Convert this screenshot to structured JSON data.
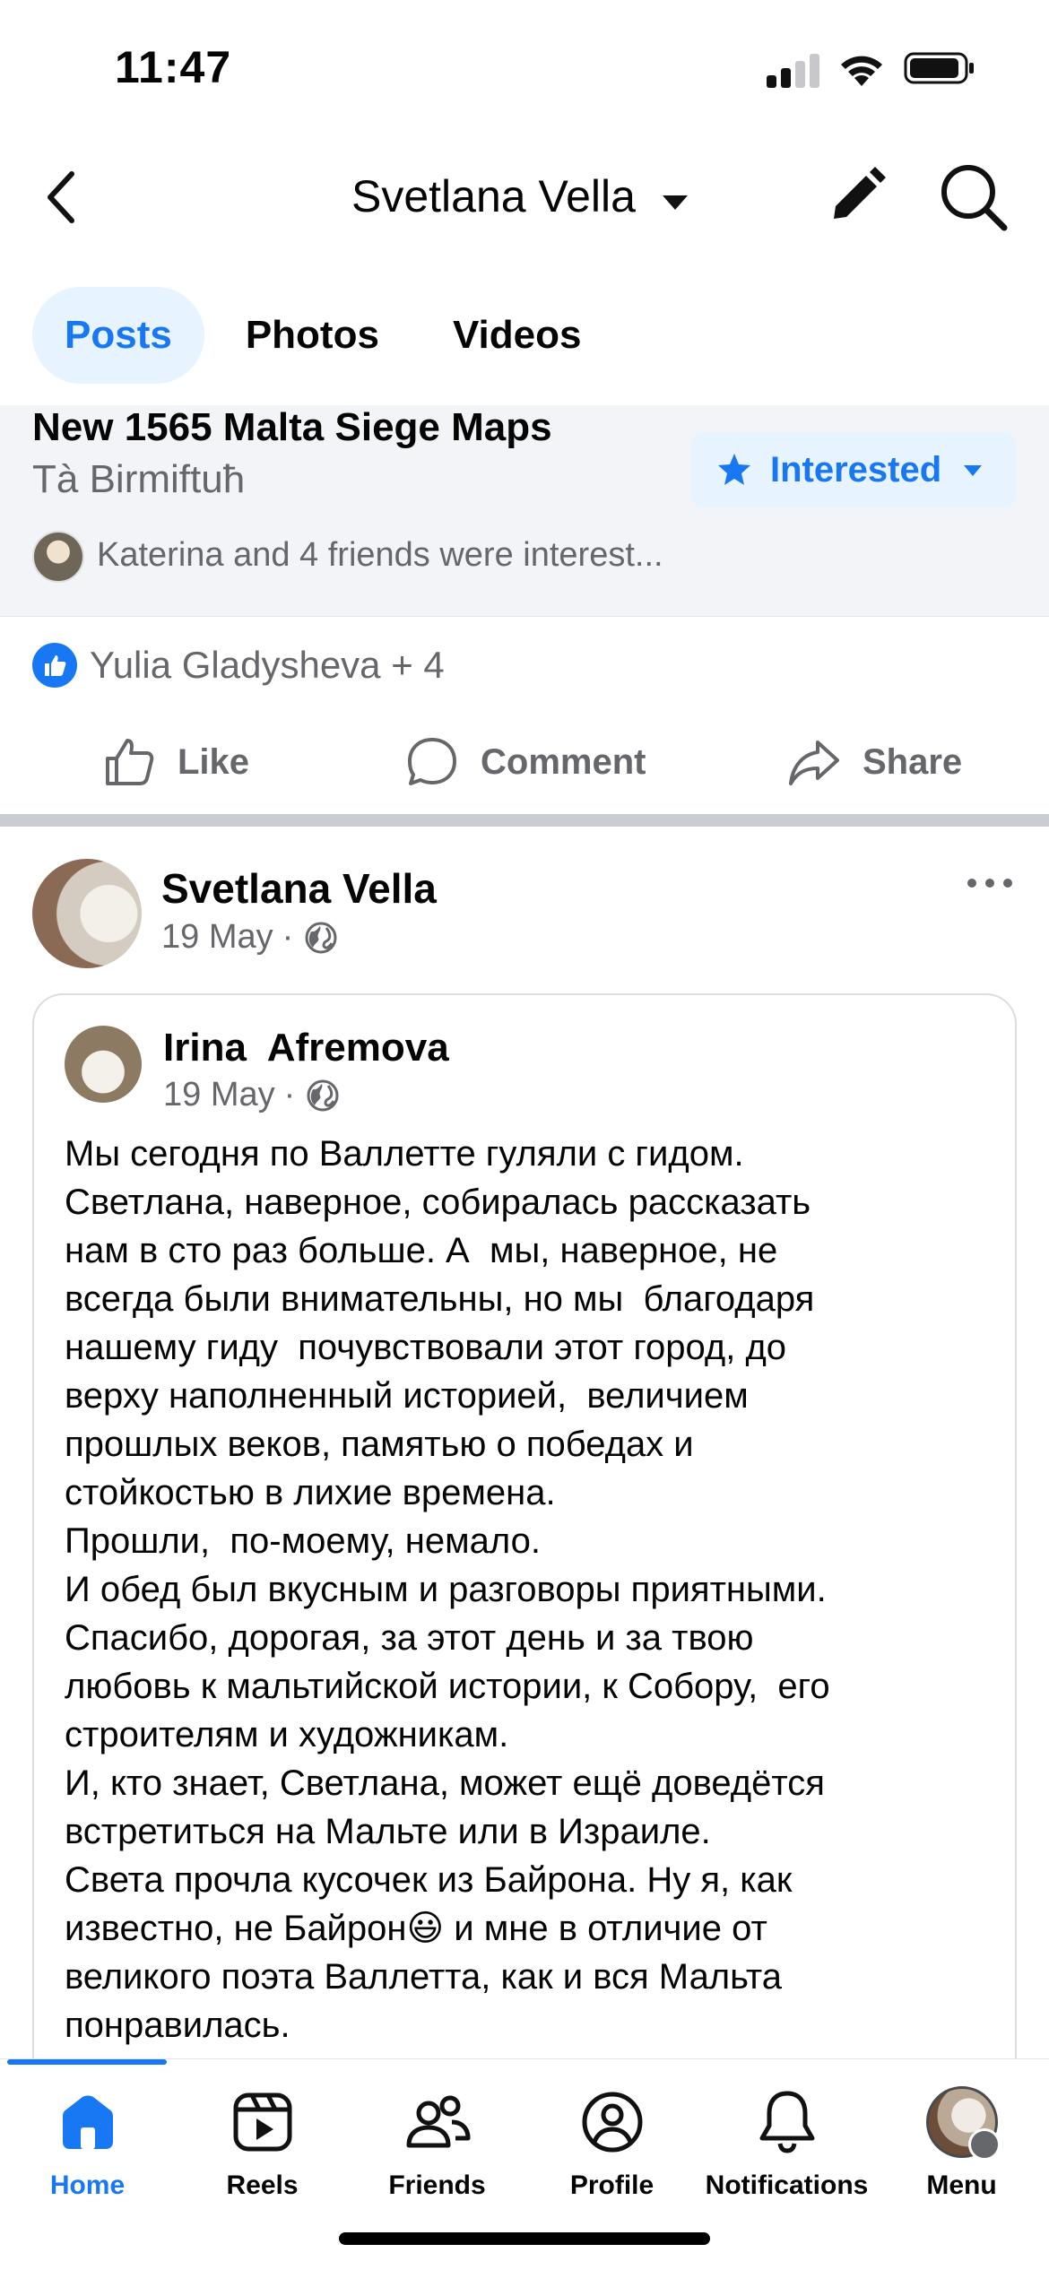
{
  "status_bar": {
    "time": "11:47"
  },
  "header": {
    "title": "Svetlana Vella"
  },
  "tabs": [
    {
      "label": "Posts",
      "active": true
    },
    {
      "label": "Photos",
      "active": false
    },
    {
      "label": "Videos",
      "active": false
    }
  ],
  "event": {
    "title": "New 1565 Malta Siege Maps",
    "location": "Tà Birmiftuħ",
    "interested_label": "Interested",
    "friends_text": "Katerina and 4 friends were interest..."
  },
  "reactions": {
    "names": "Yulia Gladysheva + 4"
  },
  "actions": {
    "like": "Like",
    "comment": "Comment",
    "share": "Share"
  },
  "post": {
    "author": "Svetlana Vella",
    "date": "19 May",
    "separator": "·",
    "shared": {
      "author": "Irina  Afremova",
      "date": "19 May",
      "separator": "·",
      "text": "Мы сегодня по Валлетте гуляли с гидом.\nСветлана, наверное, собиралась рассказать\nнам в сто раз больше. А  мы, наверное, не\nвсегда были внимательны, но мы  благодаря\nнашему гиду  почувствовали этот город, до\nверху наполненный историей,  величием\nпрошлых веков, памятью о победах и\nстойкостью в лихие времена.\nПрошли,  по-моему, немало.\nИ обед был вкусным и разговоры приятными.\nСпасибо, дорогая, за этот день и за твою\nлюбовь к мальтийской истории, к Собору,  его\nстроителям и художникам.\nИ, кто знает, Светлана, может ещё доведётся\nвстретиться на Мальте или в Израиле.\nСвета прочла кусочек из Байрона. Ну я, как\nизвестно, не Байрон😃 и мне в отличие от\nвеликого поэта Валлетта, как и вся Мальта\nпонравилась."
    }
  },
  "bottom_nav": [
    {
      "label": "Home",
      "icon": "home-icon",
      "active": true
    },
    {
      "label": "Reels",
      "icon": "reels-icon",
      "active": false
    },
    {
      "label": "Friends",
      "icon": "friends-icon",
      "active": false
    },
    {
      "label": "Profile",
      "icon": "profile-icon",
      "active": false
    },
    {
      "label": "Notifications",
      "icon": "bell-icon",
      "active": false
    },
    {
      "label": "Menu",
      "icon": "menu-avatar",
      "active": false
    }
  ],
  "colors": {
    "accent": "#1877f2",
    "accent_bg": "#e7f3ff",
    "secondary_text": "#65676b"
  }
}
